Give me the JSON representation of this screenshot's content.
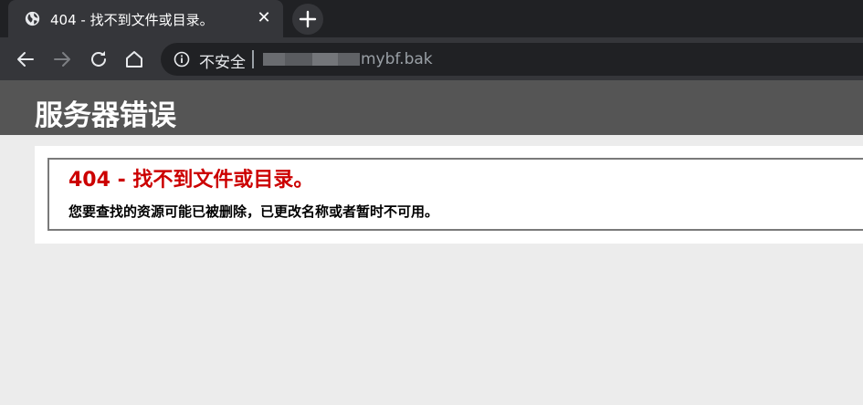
{
  "browser": {
    "tab": {
      "title": "404 - 找不到文件或目录。",
      "favicon": "globe-icon",
      "close_symbol": "✕"
    },
    "new_tab_symbol": "+",
    "toolbar": {
      "back": "arrow-left-icon",
      "forward": "arrow-right-icon",
      "reload": "reload-icon",
      "home": "home-icon"
    },
    "omnibox": {
      "security_label": "不安全",
      "url_visible_suffix": "mybf.bak"
    }
  },
  "page": {
    "header_title": "服务器错误",
    "error_title": "404 - 找不到文件或目录。",
    "error_message": "您要查找的资源可能已被删除，已更改名称或者暂时不可用。"
  },
  "colors": {
    "tabbar_bg": "#202124",
    "toolbar_bg": "#35363a",
    "header_bg": "#555555",
    "error_title": "#cc0000",
    "page_bg": "#ececec"
  }
}
